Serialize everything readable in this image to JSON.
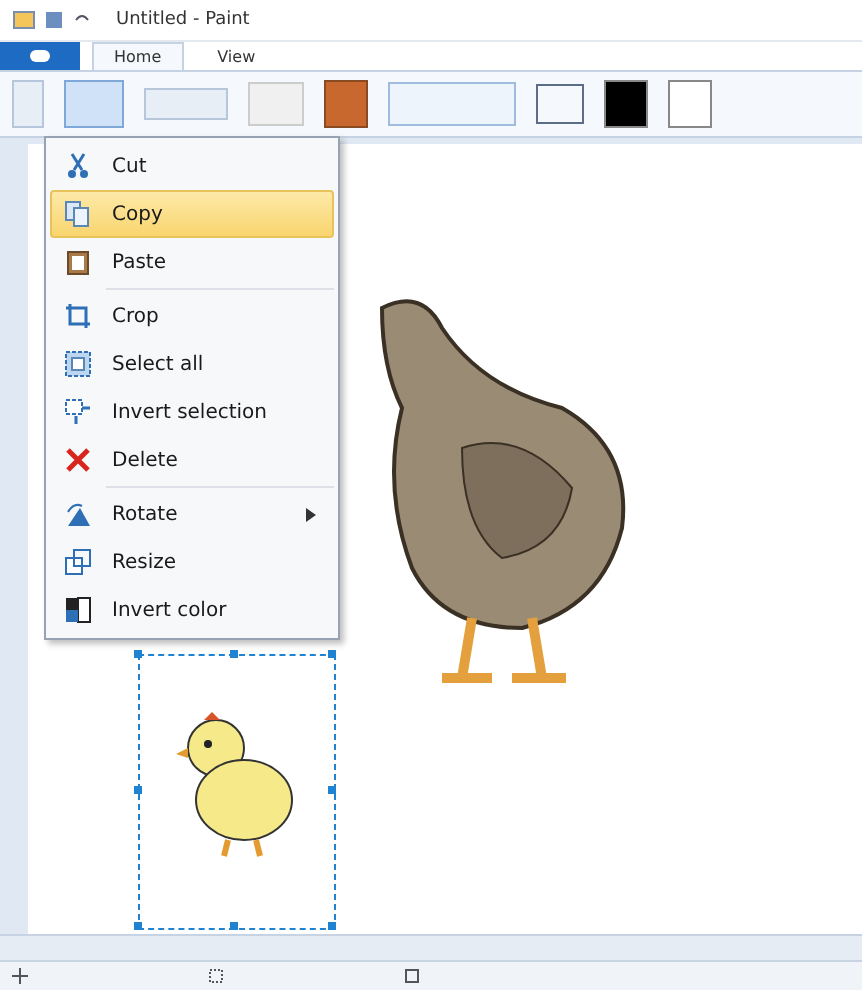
{
  "window": {
    "title": "Untitled - Paint"
  },
  "tabs": [
    {
      "label": "Home",
      "selected": true
    },
    {
      "label": "View",
      "selected": false
    }
  ],
  "context_menu": {
    "groups": [
      [
        {
          "label": "Cut",
          "kind": "cut",
          "selected": false,
          "submenu": false
        },
        {
          "label": "Copy",
          "kind": "copy",
          "selected": true,
          "submenu": false
        },
        {
          "label": "Paste",
          "kind": "paste",
          "selected": false,
          "submenu": false
        }
      ],
      [
        {
          "label": "Crop",
          "kind": "crop",
          "selected": false,
          "submenu": false
        },
        {
          "label": "Select all",
          "kind": "selectall",
          "selected": false,
          "submenu": false
        },
        {
          "label": "Invert selection",
          "kind": "invertsel",
          "selected": false,
          "submenu": false
        },
        {
          "label": "Delete",
          "kind": "delete",
          "selected": false,
          "submenu": false
        }
      ],
      [
        {
          "label": "Rotate",
          "kind": "rotate",
          "selected": false,
          "submenu": true
        },
        {
          "label": "Resize",
          "kind": "resize",
          "selected": false,
          "submenu": false
        },
        {
          "label": "Invert color",
          "kind": "invertcolor",
          "selected": false,
          "submenu": false
        }
      ]
    ]
  }
}
